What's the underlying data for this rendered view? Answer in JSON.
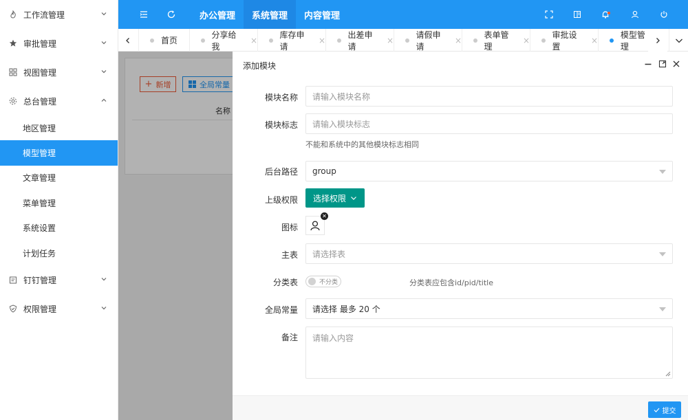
{
  "sidebar": {
    "groups": [
      {
        "label": "工作流管理",
        "icon": "fire-icon"
      },
      {
        "label": "审批管理",
        "icon": "star-icon"
      },
      {
        "label": "视图管理",
        "icon": "grid-icon"
      },
      {
        "label": "总台管理",
        "icon": "gear-icon"
      },
      {
        "label": "钉钉管理",
        "icon": "calendar-icon"
      },
      {
        "label": "权限管理",
        "icon": "shield-icon"
      }
    ],
    "subitems": [
      "地区管理",
      "模型管理",
      "文章管理",
      "菜单管理",
      "系统设置",
      "计划任务"
    ]
  },
  "topbar": {
    "nav": [
      "办公管理",
      "系统管理",
      "内容管理"
    ]
  },
  "tabs": {
    "items": [
      "首页",
      "分享给我",
      "库存申请",
      "出差申请",
      "请假申请",
      "表单管理",
      "审批设置",
      "模型管理"
    ],
    "close_glyph": "×"
  },
  "background": {
    "add_label": "新增",
    "const_label": "全局常量",
    "column_label": "名称"
  },
  "modal": {
    "title": "添加模块",
    "fields": {
      "name": {
        "label": "模块名称",
        "placeholder": "请输入模块名称"
      },
      "flag": {
        "label": "模块标志",
        "placeholder": "请输入模块标志",
        "hint": "不能和系统中的其他模块标志相同"
      },
      "route": {
        "label": "后台路径",
        "value": "group"
      },
      "parent": {
        "label": "上级权限",
        "button": "选择权限"
      },
      "icon": {
        "label": "图标",
        "remove_glyph": "✕"
      },
      "main_table": {
        "label": "主表",
        "placeholder": "请选择表"
      },
      "category": {
        "label": "分类表",
        "toggle_text": "不分类",
        "hint": "分类表应包含id/pid/title"
      },
      "constants": {
        "label": "全局常量",
        "placeholder": "请选择 最多 20 个"
      },
      "remark": {
        "label": "备注",
        "placeholder": "请输入内容"
      }
    },
    "submit": "提交"
  },
  "colors": {
    "primary": "#2196f3",
    "teal": "#009688",
    "danger": "#ee5a36"
  }
}
